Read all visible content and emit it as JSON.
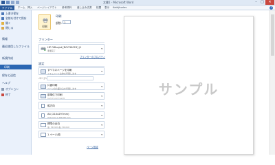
{
  "titlebar": {
    "title": "文書1 - Microsoft Word",
    "qat_icons": [
      "word-icon",
      "save-icon",
      "undo-icon",
      "redo-icon"
    ],
    "controls": [
      "minimize-icon",
      "maximize-icon",
      "close-icon"
    ]
  },
  "ribbon": {
    "file_tab": "ファイル",
    "tabs": [
      "ホーム",
      "挿入",
      "ページレイアウト",
      "参考資料",
      "差し込み文書",
      "校閲",
      "表示",
      "Kathjhorles"
    ],
    "help_icon": "help-icon"
  },
  "backstage": {
    "items": [
      {
        "label": "上書き保存",
        "icon": "save-icon"
      },
      {
        "label": "名前を付けて保存",
        "icon": "save-as-icon"
      },
      {
        "label": "開く",
        "icon": "folder-open-icon"
      },
      {
        "label": "閉じる",
        "icon": "close-file-icon"
      }
    ],
    "info": "情報",
    "recent": "最近使用したファイル",
    "new": "新規作成",
    "print": "印刷",
    "save_send": "保存と送信",
    "help": "ヘルプ",
    "options": {
      "label": "オプション",
      "icon": "options-icon"
    },
    "exit": {
      "label": "終了",
      "icon": "exit-icon"
    }
  },
  "print_panel": {
    "title": "印刷",
    "print_button": "印刷",
    "copies_label": "部数:",
    "copies_value": "1",
    "printer_section": "プリンター",
    "printer_name": "HP Officejet [DOC30023] (1",
    "printer_status": "準備完了",
    "printer_props": "プリンターのプロパティ",
    "settings_section": "設定",
    "settings": [
      {
        "l1": "すべてのページを印刷",
        "l2": "ドキュメント全体を印刷します"
      },
      {
        "l1": "片面印刷",
        "l2": "ページの片面のみを印刷します"
      },
      {
        "l1": "部単位で印刷",
        "l2": "1,2,3   1,2,3   1,2,3"
      },
      {
        "l1": "縦方向",
        "l2": ""
      },
      {
        "l1": "A4 (210x297mm)",
        "l2": "210 mm x 296.98 mm"
      },
      {
        "l1": "標準の余白",
        "l2": "左: 30 mm   右: 30 mm"
      },
      {
        "l1": "1 ページ/枚",
        "l2": ""
      }
    ],
    "pages_label": "ページ:",
    "page_setup": "ページ設定"
  },
  "preview": {
    "watermark": "サンプル"
  },
  "colors": {
    "file_tab": "#2a5a9c",
    "active_nav": "#2a66b3",
    "backstage_bg": "#eaf1fb",
    "close_button": "#c9483f"
  }
}
